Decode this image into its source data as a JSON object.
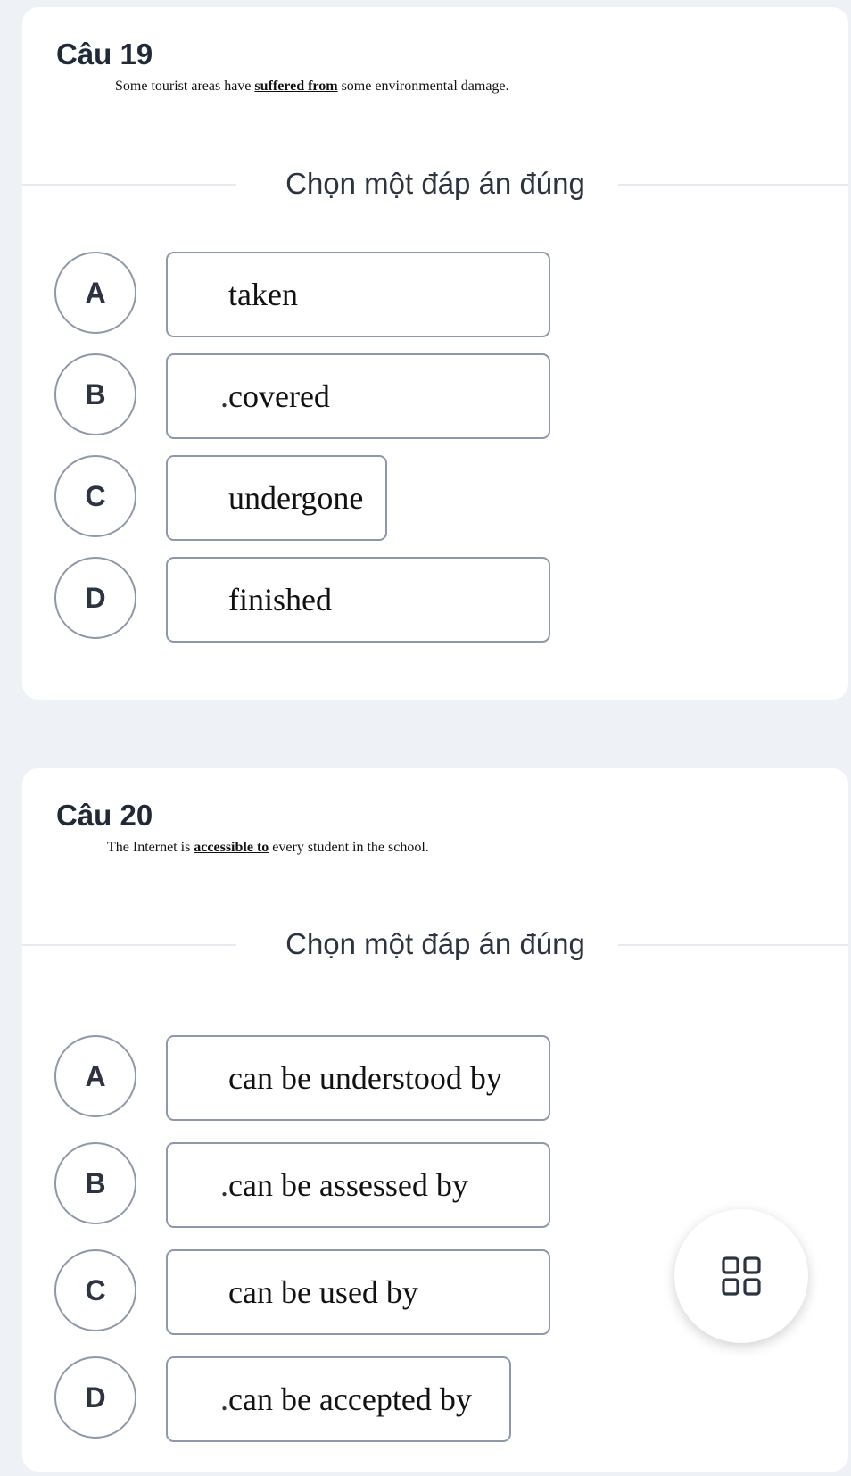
{
  "questions": [
    {
      "title": "Câu 19",
      "stem": {
        "before": "Some tourist areas have ",
        "underlined": "suffered from",
        "after": " some environmental damage."
      },
      "prompt": "Chọn một đáp án đúng",
      "options": [
        {
          "letter": "A",
          "lead": "",
          "text": "taken"
        },
        {
          "letter": "B",
          "lead": ".",
          "text": "covered"
        },
        {
          "letter": "C",
          "lead": "",
          "text": "undergone"
        },
        {
          "letter": "D",
          "lead": "",
          "text": "finished"
        }
      ]
    },
    {
      "title": "Câu 20",
      "stem": {
        "before": "The Internet is ",
        "underlined": "accessible to",
        "after": " every student in the school."
      },
      "prompt": "Chọn một đáp án đúng",
      "options": [
        {
          "letter": "A",
          "lead": "",
          "text": "can be understood by"
        },
        {
          "letter": "B",
          "lead": ".",
          "text": "can be assessed by"
        },
        {
          "letter": "C",
          "lead": "",
          "text": "can be used by"
        },
        {
          "letter": "D",
          "lead": ".",
          "text": "can be accepted by"
        }
      ]
    }
  ],
  "fab": {
    "icon": "grid-icon"
  },
  "colors": {
    "page_bg": "#eef1f6",
    "card_bg": "#ffffff",
    "border": "#8d98ab"
  }
}
